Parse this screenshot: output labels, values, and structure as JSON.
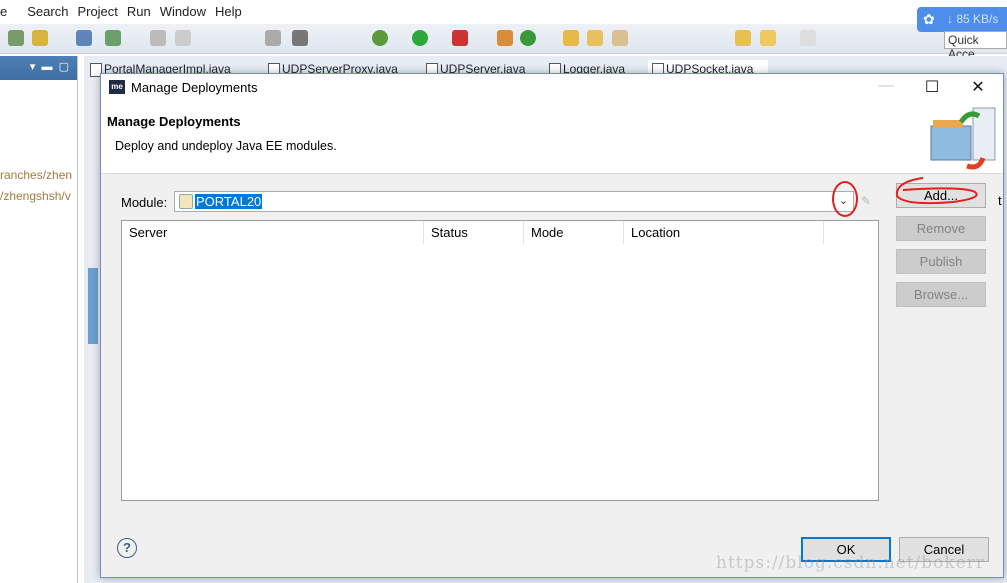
{
  "menu": [
    "e",
    "Search",
    "Project",
    "Run",
    "Window",
    "Help"
  ],
  "net_speed": {
    "icon": "baidu-cloud-icon",
    "text": "↓ 85 KB/s"
  },
  "quick_access": "Quick Acce",
  "left_panel": {
    "lines": [
      "ranches/zhen",
      "/zhengshsh/v"
    ]
  },
  "editor_tabs": [
    "PortalManagerImpl.java",
    "UDPServerProxy.java",
    "UDPServer.java",
    "Logger.java",
    "UDPSocket.java"
  ],
  "dialog": {
    "title": "Manage Deployments",
    "app_icon": "me",
    "heading": "Manage Deployments",
    "description": "Deploy and undeploy Java EE modules.",
    "module_label": "Module:",
    "module_value": "PORTAL20",
    "columns": [
      "Server",
      "Status",
      "Mode",
      "Location"
    ],
    "rows": [],
    "buttons": {
      "add": "Add...",
      "remove": "Remove",
      "publish": "Publish",
      "browse": "Browse..."
    },
    "ok": "OK",
    "cancel": "Cancel",
    "help": "?"
  },
  "side_text": "t",
  "watermark": "https://blog.csdn.net/bokerr",
  "annotation_color": "#e02020"
}
